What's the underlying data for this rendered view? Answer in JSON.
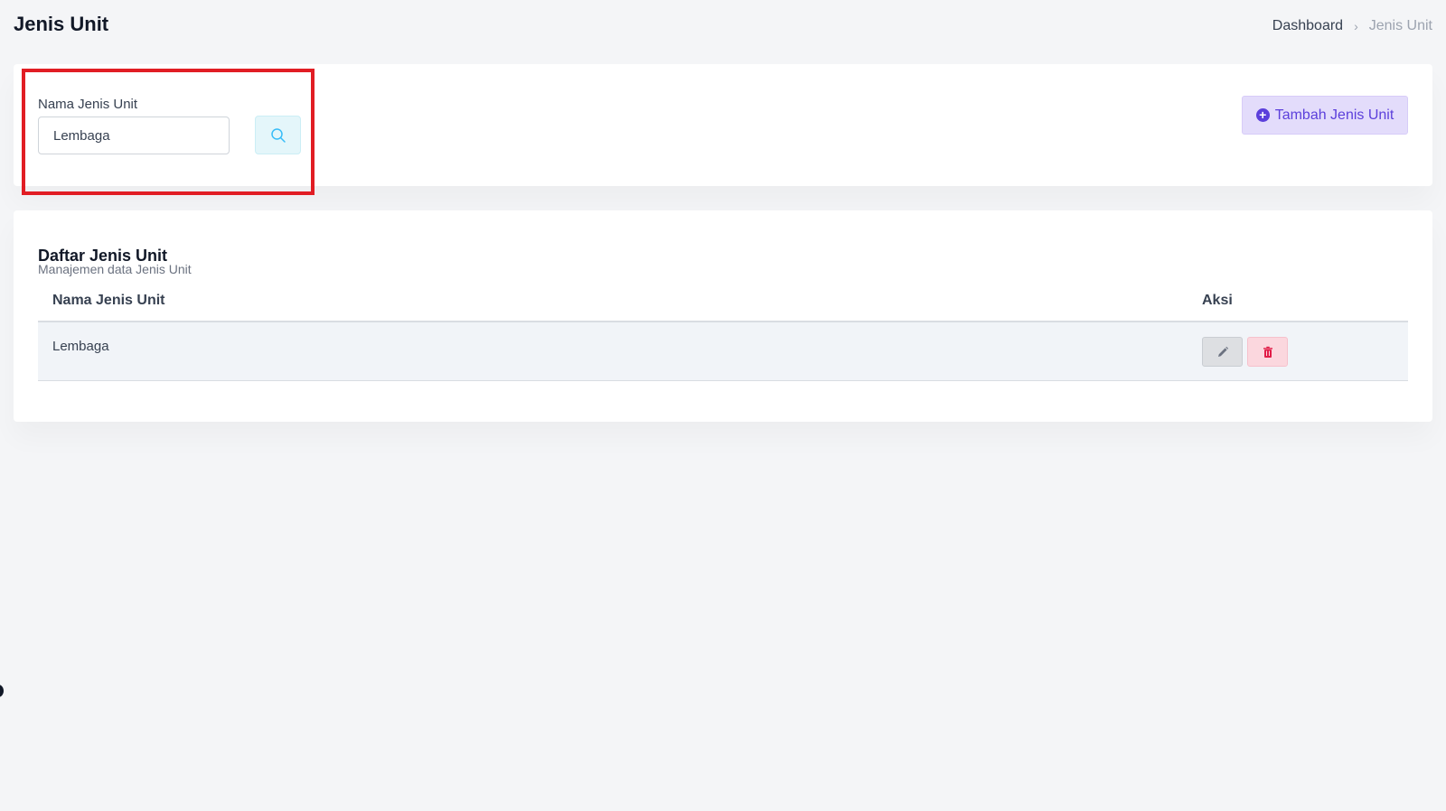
{
  "header": {
    "title": "Jenis Unit",
    "breadcrumb": {
      "home": "Dashboard",
      "separator": "›",
      "current": "Jenis Unit"
    }
  },
  "filter": {
    "label": "Nama Jenis Unit",
    "input_value": "Lembaga",
    "search_icon": "search-icon",
    "add_button_label": "Tambah Jenis Unit",
    "add_button_icon": "plus-circle-icon"
  },
  "list": {
    "title": "Daftar Jenis Unit",
    "subtitle": "Manajemen data Jenis Unit",
    "columns": {
      "name": "Nama Jenis Unit",
      "actions": "Aksi"
    },
    "rows": [
      {
        "name": "Lembaga",
        "edit_icon": "pencil-icon",
        "delete_icon": "trash-icon"
      }
    ]
  },
  "colors": {
    "background": "#f4f5f7",
    "card": "#ffffff",
    "primary": "#5b3fdb",
    "highlight": "#e11d24",
    "info": "#38bdf8",
    "danger": "#e11d48"
  }
}
